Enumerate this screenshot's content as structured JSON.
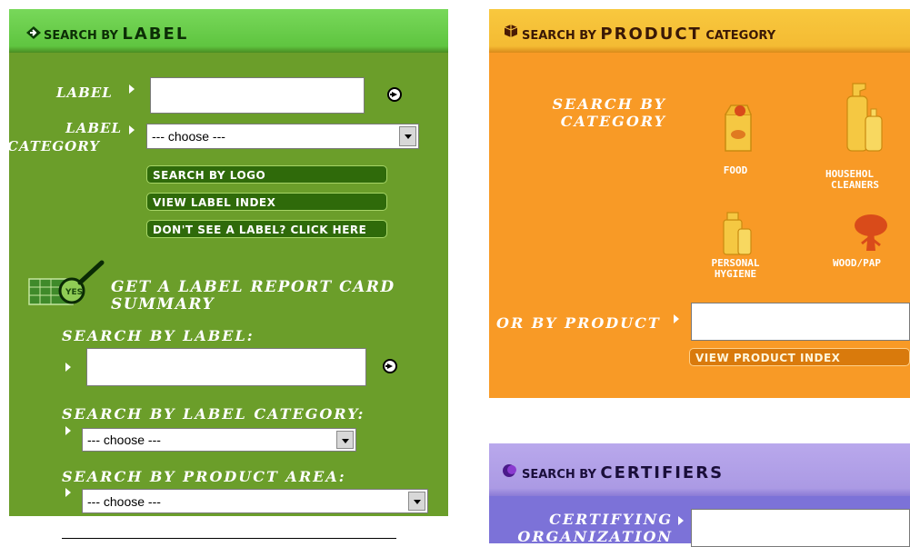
{
  "label_panel": {
    "header_prefix": "SEARCH BY",
    "header_main": "LABEL",
    "label_field": {
      "label": "LABEL",
      "value": ""
    },
    "label_category": {
      "line1": "LABEL",
      "line2": "CATEGORY",
      "selected": "--- choose ---"
    },
    "buttons": {
      "search_by_logo": "SEARCH BY LOGO",
      "view_label_index": "VIEW LABEL INDEX",
      "dont_see_label": "DON'T SEE A LABEL? CLICK HERE"
    },
    "report_card": {
      "icon_text": "YES",
      "title_line1": "GET A LABEL REPORT CARD",
      "title_line2": "SUMMARY",
      "search_by_label": "SEARCH BY LABEL:",
      "search_by_label_category": "SEARCH BY LABEL CATEGORY:",
      "category_selected": "--- choose ---",
      "search_by_product_area": "SEARCH BY PRODUCT AREA:",
      "product_area_selected": "--- choose ---"
    }
  },
  "product_panel": {
    "header_prefix": "SEARCH BY",
    "header_main": "PRODUCT",
    "header_suffix": "CATEGORY",
    "search_by_category_line1": "SEARCH BY",
    "search_by_category_line2": "CATEGORY",
    "categories": [
      {
        "line1": "FOOD",
        "line2": ""
      },
      {
        "line1": "HOUSEHOL",
        "line2": "CLEANERS"
      },
      {
        "line1": "PERSONAL",
        "line2": "HYGIENE"
      },
      {
        "line1": "WOOD/PAP",
        "line2": ""
      }
    ],
    "or_by_product": "OR BY PRODUCT",
    "product_value": "",
    "view_product_index": "VIEW PRODUCT INDEX"
  },
  "certifiers_panel": {
    "header_prefix": "SEARCH BY",
    "header_main": "CERTIFIERS",
    "certifying_line1": "CERTIFYING",
    "certifying_line2": "ORGANIZATION"
  },
  "colors": {
    "green_header": "#6fd24f",
    "green_body": "#6b9e2a",
    "orange_header": "#f6c23a",
    "orange_body": "#f89a26",
    "purple_header": "#b3a2e8",
    "purple_body": "#7c72d8"
  }
}
